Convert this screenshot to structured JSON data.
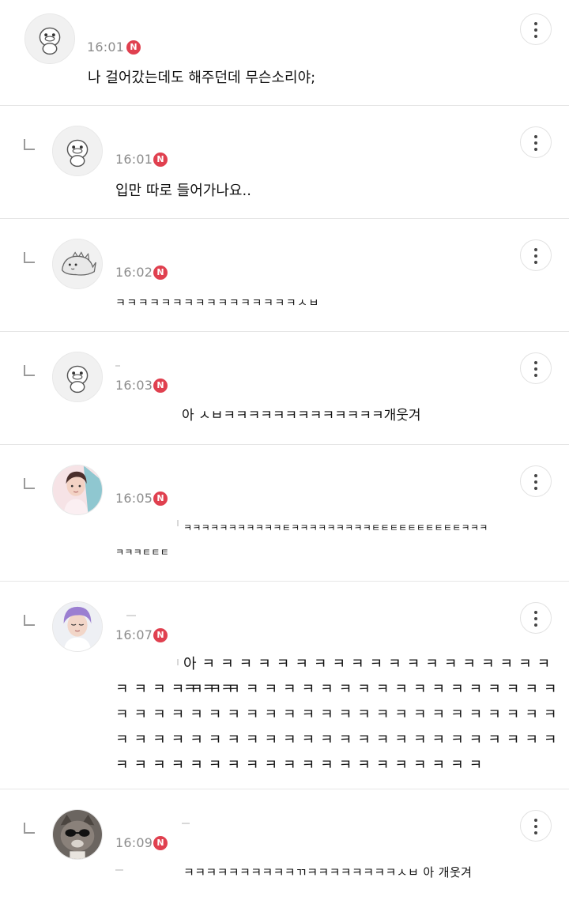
{
  "comments": [
    {
      "time": "16:01",
      "badge": "N",
      "text": "나 걸어갔는데도 해주던데 무슨소리야;",
      "avatar_icon": "chick-character-icon"
    },
    {
      "time": "16:01",
      "badge": "N",
      "text": "입만 따로 들어가나요..",
      "avatar_icon": "chick-character-icon"
    },
    {
      "time": "16:02",
      "badge": "N",
      "text": "ㅋㅋㅋㅋㅋㅋㅋㅋㅋㅋㅋㅋㅋㅋㅋㅋㅅㅂ",
      "avatar_icon": "dinosaur-character-icon"
    },
    {
      "time": "16:03",
      "badge": "N",
      "text": "아 ㅅㅂㅋㅋㅋㅋㅋㅋㅋㅋㅋㅋㅋㅋㅋ개웃겨",
      "avatar_icon": "chick-character-icon"
    },
    {
      "time": "16:05",
      "badge": "N",
      "text_line1": "ㅋㅋㅋㅋㅋㅋㅋㅋㅋㅋㅋㅌㅋㅋㅋㅋㅋㅋㅋㅋㅋㅌㅌㅌㅌㅌㅌㅌㅌㅌㅌㅋㅋㅋ",
      "text_line2": "ㅋㅋㅋㅌㅌㅌ",
      "avatar_icon": "profile-photo"
    },
    {
      "time": "16:07",
      "badge": "N",
      "text_line1": "아ㅋㅋㅋㅋㅋㅋㅋㅋㅋㅋㅋㅋㅋㅋㅋㅋㅋㅋㅋㅋㅋㅋ",
      "text_line2": "ㅋㅋㅋㅋㅋㅋㅋㅋㅋㅋㅋㅋㅋㅋㅋㅋㅋㅋㅋㅋㅋㅋㅋㅋ",
      "text_line3": "ㅋㅋㅋㅋㅋㅋㅋㅋㅋㅋㅋㅋㅋㅋㅋㅋㅋㅋㅋㅋㅋㅋㅋㅋ",
      "text_line4": "ㅋㅋㅋㅋㅋㅋㅋㅋㅋㅋㅋㅋㅋㅋㅋㅋㅋㅋㅋㅋㅋㅋㅋㅋ",
      "text_line5": "ㅋㅋㅋㅋㅋㅋㅋㅋㅋㅋㅋㅋㅋㅋㅋㅋㅋㅋㅋㅋ",
      "avatar_icon": "profile-photo"
    },
    {
      "time": "16:09",
      "badge": "N",
      "text": "ㅋㅋㅋㅋㅋㅋㅋㅋㅋㅋㄲㅋㅋㅋㅋㅋㅋㅋㅋㅅㅂ 아 개웃겨",
      "avatar_icon": "cat-photo"
    }
  ],
  "colors": {
    "badge": "#e0404f",
    "time": "#8c8c8c",
    "divider": "#e6e6e6"
  },
  "icons": {
    "more": "more-vertical-icon",
    "reply": "reply-arrow-icon"
  }
}
